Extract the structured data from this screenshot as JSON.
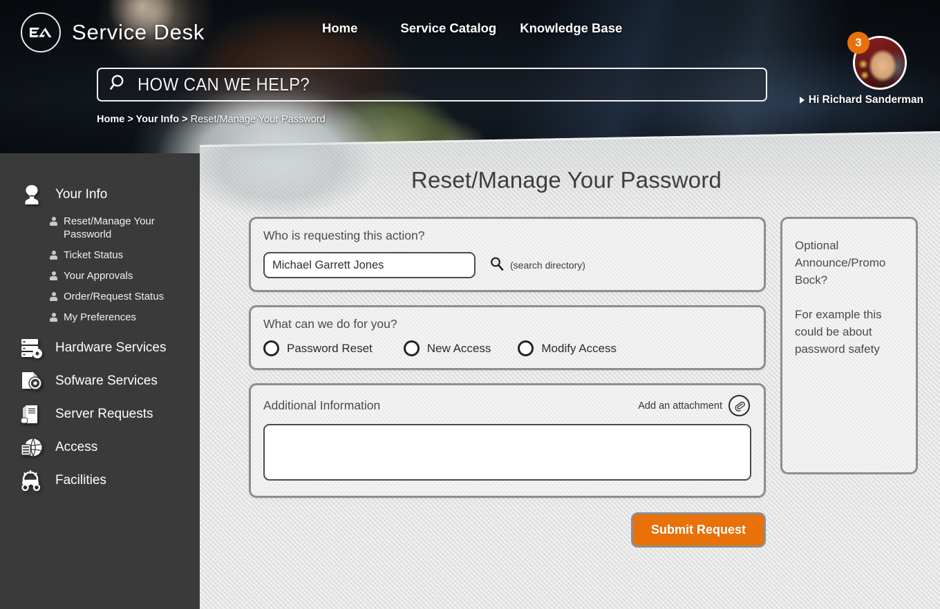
{
  "brand": {
    "logo_text": "EA",
    "title": "Service Desk"
  },
  "topnav": {
    "items": [
      {
        "label": "Home"
      },
      {
        "label": "Service  Catalog"
      },
      {
        "label": "Knowledge Base"
      }
    ]
  },
  "search": {
    "placeholder": "HOW CAN WE HELP?",
    "value": "",
    "icon": "search-icon"
  },
  "breadcrumb": {
    "trail": "Home > Your Info >",
    "current": "Reset/Manage Your Password"
  },
  "user": {
    "greeting": "Hi Richard Sanderman",
    "notification_count": "3",
    "badge_color": "#E8710A"
  },
  "sidebar": {
    "groups": [
      {
        "label": "Your Info",
        "icon": "person-bust-icon",
        "items": [
          {
            "label": "Reset/Manage Your Passworld",
            "icon": "person-small-icon"
          },
          {
            "label": "Ticket Status",
            "icon": "person-small-icon"
          },
          {
            "label": "Your Approvals",
            "icon": "person-small-icon"
          },
          {
            "label": "Order/Request Status",
            "icon": "person-small-icon"
          },
          {
            "label": "My Preferences",
            "icon": "person-small-icon"
          }
        ]
      },
      {
        "label": "Hardware Services",
        "icon": "server-gear-icon",
        "items": []
      },
      {
        "label": "Sofware Services",
        "icon": "disc-document-icon",
        "items": []
      },
      {
        "label": "Server Requests",
        "icon": "server-rack-icon",
        "items": []
      },
      {
        "label": "Access",
        "icon": "globe-server-icon",
        "items": []
      },
      {
        "label": "Facilities",
        "icon": "gear-wrench-icon",
        "items": []
      }
    ]
  },
  "main": {
    "page_title": "Reset/Manage Your Password",
    "requester": {
      "label": "Who is requesting this action?",
      "value": "Michael Garrett Jones",
      "placeholder": "",
      "directory_link": "(search directory)",
      "directory_icon": "search-icon"
    },
    "action": {
      "label": "What can we do for you?",
      "options": [
        {
          "label": "Password Reset",
          "selected": false
        },
        {
          "label": "New Access",
          "selected": false
        },
        {
          "label": "Modify Access",
          "selected": false
        }
      ]
    },
    "additional": {
      "label": "Additional Information",
      "attachment_label": "Add an attachment",
      "attachment_icon": "paperclip-icon",
      "value": "",
      "placeholder": ""
    },
    "submit_label": "Submit Request",
    "submit_color": "#E8710A"
  },
  "promo": {
    "heading": "Optional Announce/Promo Bock?",
    "body": "For example this could be about password safety"
  }
}
